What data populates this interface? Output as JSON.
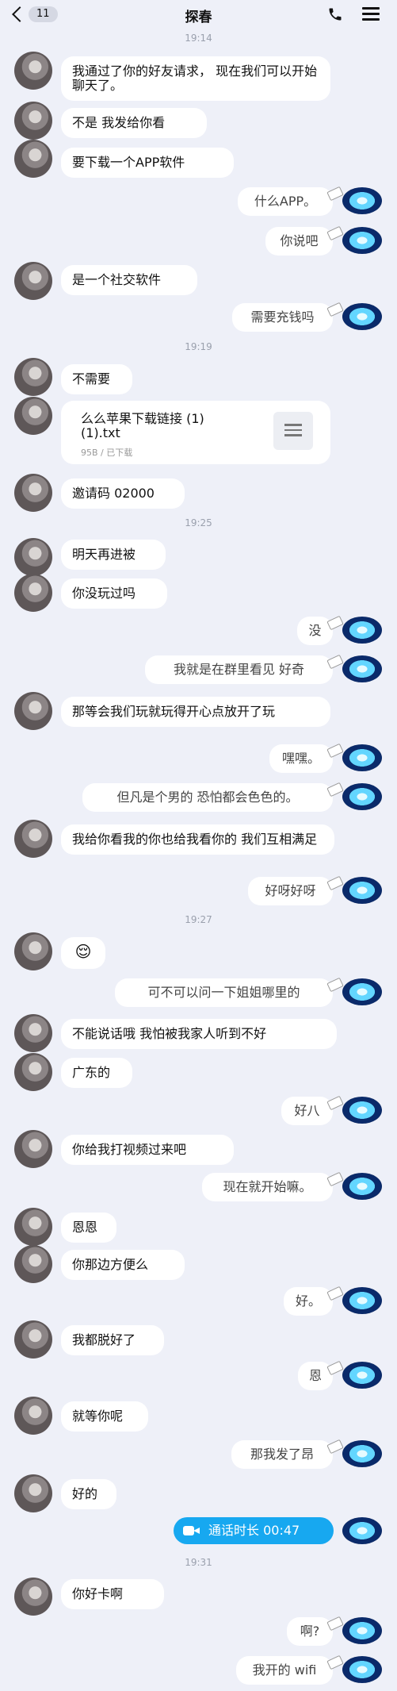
{
  "header": {
    "back_count": "11",
    "title": "探春"
  },
  "timestamps": [
    "19:14",
    "19:19",
    "19:25",
    "19:27",
    "19:31"
  ],
  "messages": {
    "m1": "我通过了你的好友请求， 现在我们可以开始聊天了。",
    "m2": "不是  我发给你看",
    "m3": "要下载一个APP软件",
    "m4": "什么APP。",
    "m5": "你说吧",
    "m6": "是一个社交软件",
    "m7": "需要充钱吗",
    "m8": "不需要",
    "file_name": "么么苹果下载链接 (1) (1).txt",
    "file_meta": "95B / 已下载",
    "m9": "邀请码 02000",
    "m10": "明天再进被",
    "m11": "你没玩过吗",
    "m12": "没",
    "m13": "我就是在群里看见 好奇",
    "m14": "那等会我们玩就玩得开心点放开了玩",
    "m15": "嘿嘿。",
    "m16": "但凡是个男的 恐怕都会色色的。",
    "m17": "我给你看我的你也给我看你的 我们互相满足",
    "m18": "好呀好呀",
    "m19": "😌",
    "m20": "可不可以问一下姐姐哪里的",
    "m21": "不能说话哦 我怕被我家人听到不好",
    "m22": "广东的",
    "m23": "好八",
    "m24": "你给我打视频过来吧",
    "m25": "现在就开始嘛。",
    "m26": "恩恩",
    "m27": "你那边方便么",
    "m28": "好。",
    "m29": "我都脱好了",
    "m30": "恩",
    "m31": "就等你呢",
    "m32": "那我发了昂",
    "m33": "好的",
    "call": "通话时长 00:47",
    "m34": "你好卡啊",
    "m35": "啊?",
    "m36": "我开的 wifi"
  }
}
